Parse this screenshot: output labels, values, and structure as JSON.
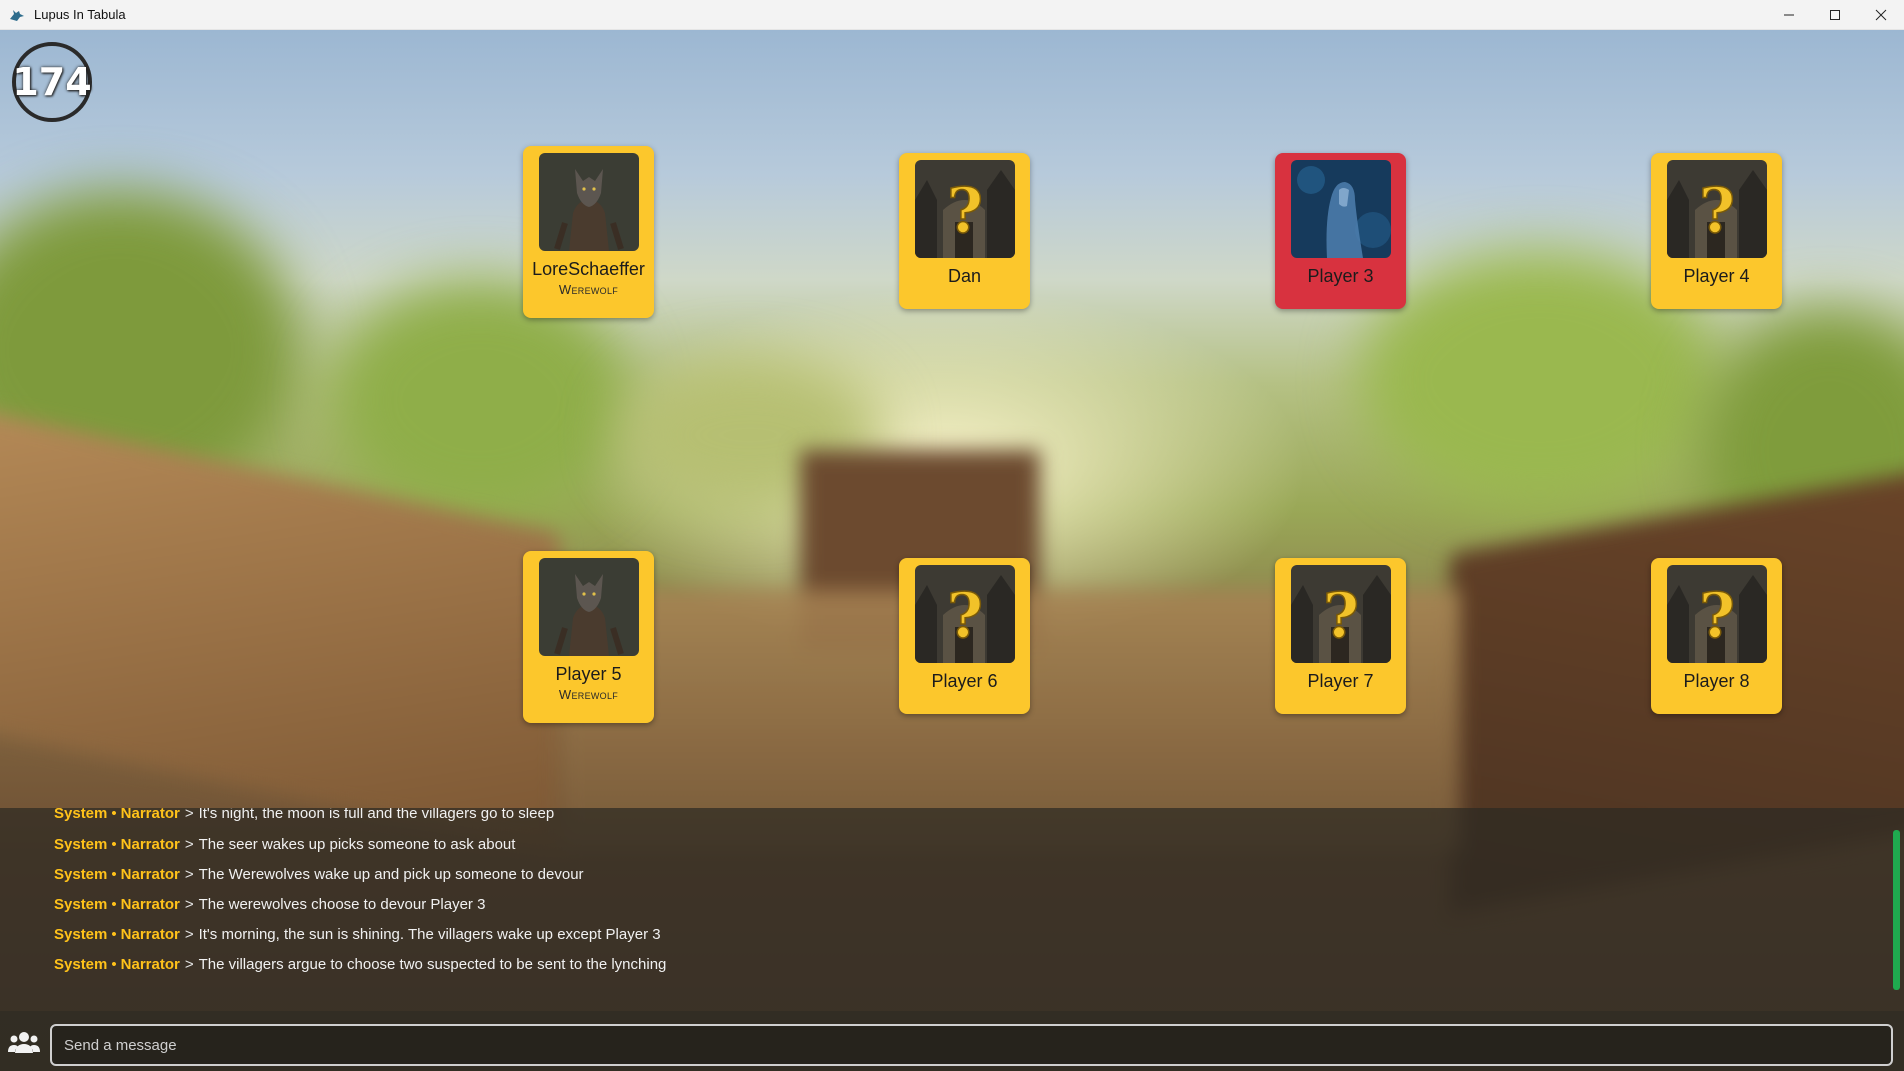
{
  "window": {
    "title": "Lupus In Tabula",
    "controls": [
      "minimize",
      "maximize",
      "close"
    ]
  },
  "timer": {
    "value": "174"
  },
  "players": [
    {
      "name": "LoreSchaeffer",
      "role": "Werewolf",
      "portrait": "werewolf",
      "status": "alive"
    },
    {
      "name": "Dan",
      "role": "",
      "portrait": "unknown",
      "status": "alive"
    },
    {
      "name": "Player 3",
      "role": "",
      "portrait": "ghost",
      "status": "dead"
    },
    {
      "name": "Player 4",
      "role": "",
      "portrait": "unknown",
      "status": "alive"
    },
    {
      "name": "Player 5",
      "role": "Werewolf",
      "portrait": "werewolf",
      "status": "alive"
    },
    {
      "name": "Player 6",
      "role": "",
      "portrait": "unknown",
      "status": "alive"
    },
    {
      "name": "Player 7",
      "role": "",
      "portrait": "unknown",
      "status": "alive"
    },
    {
      "name": "Player 8",
      "role": "",
      "portrait": "unknown",
      "status": "alive"
    }
  ],
  "chat": {
    "messages": [
      {
        "source": "System",
        "author": "Narrator",
        "separator": ">",
        "text": "It's night, the moon is full and the villagers go to sleep"
      },
      {
        "source": "System",
        "author": "Narrator",
        "separator": ">",
        "text": "The seer wakes up picks someone to ask about"
      },
      {
        "source": "System",
        "author": "Narrator",
        "separator": ">",
        "text": "The Werewolves wake up and pick up someone to devour"
      },
      {
        "source": "System",
        "author": "Narrator",
        "separator": ">",
        "text": "The werewolves choose to devour Player 3"
      },
      {
        "source": "System",
        "author": "Narrator",
        "separator": ">",
        "text": "It's morning, the sun is shining. The villagers wake up except Player 3"
      },
      {
        "source": "System",
        "author": "Narrator",
        "separator": ">",
        "text": "The villagers argue to choose two suspected to be sent to the lynching"
      }
    ],
    "input_placeholder": "Send a message",
    "users_icon": "users-icon"
  },
  "colors": {
    "card": "#fcc72c",
    "card_dead": "#d8323f",
    "chat_highlight": "#ffc21a",
    "scrollbar": "#1fa94f"
  }
}
